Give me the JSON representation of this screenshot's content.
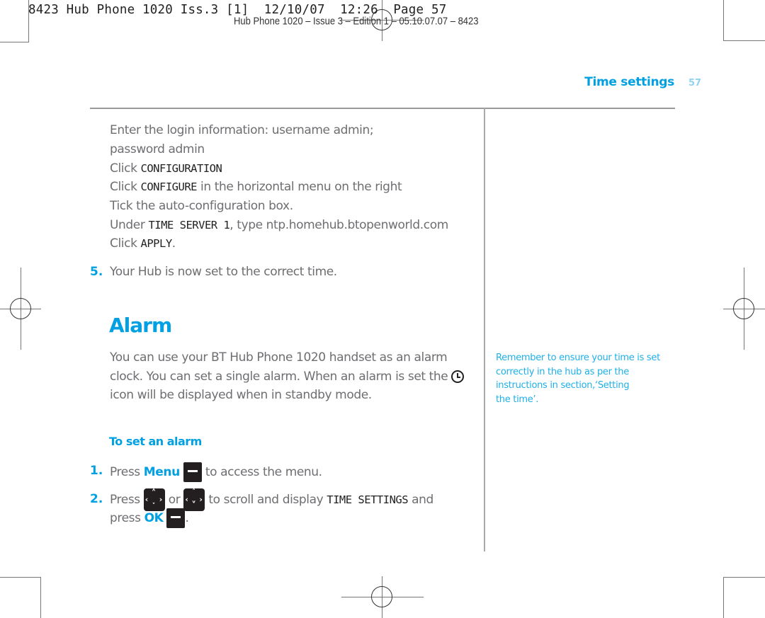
{
  "print_slug": {
    "main": "8423 Hub Phone 1020 Iss.3 [1]  12/10/07  12:26  Page 57",
    "secondary": "Hub Phone 1020 – Issue 3 – Edition 1 – 05.10.07.07 – 8423"
  },
  "header": {
    "section_title": "Time settings",
    "page_number": "57"
  },
  "steps_continued": [
    {
      "pre": "Enter the login information: username admin;",
      "lcd": "",
      "post": ""
    },
    {
      "pre": "password admin",
      "lcd": "",
      "post": ""
    },
    {
      "pre": "Click ",
      "lcd": "CONFIGURATION",
      "post": ""
    },
    {
      "pre": "Click ",
      "lcd": "CONFIGURE",
      "post": " in the horizontal menu on the right"
    },
    {
      "pre": "Tick the auto-configuration box.",
      "lcd": "",
      "post": ""
    },
    {
      "pre": "Under ",
      "lcd": "TIME SERVER 1",
      "post": ", type ntp.homehub.btopenworld.com"
    },
    {
      "pre": "Click ",
      "lcd": "APPLY",
      "post": "."
    }
  ],
  "step5": {
    "number": "5.",
    "text": "Your Hub is now set to the correct time."
  },
  "alarm": {
    "title": "Alarm",
    "para_line1": "You can use your BT Hub Phone 1020 handset as an alarm",
    "para_line2": "clock. You can set a single alarm. When an alarm is set the",
    "para_line3": "icon will be displayed when in standby mode.",
    "icon": "alarm-clock-icon"
  },
  "to_set": {
    "title": "To set an alarm",
    "step1": {
      "number": "1.",
      "pre": "Press ",
      "key_label": "Menu",
      "post": " to access the menu."
    },
    "step2": {
      "number": "2.",
      "pre": "Press ",
      "mid": " or ",
      "post": " to scroll and display ",
      "lcd": "TIME SETTINGS",
      "post2": " and",
      "line2_pre": "press ",
      "key_label": "OK",
      "line2_post": "."
    }
  },
  "side_note": {
    "line1": "Remember to ensure your time is set",
    "line2": "correctly in the hub as per the",
    "line3": "instructions in section,‘Setting",
    "line4": "the time’."
  },
  "colors": {
    "accent": "#00a0e3",
    "body_text": "#6d6e71",
    "key_fill": "#231f20"
  }
}
